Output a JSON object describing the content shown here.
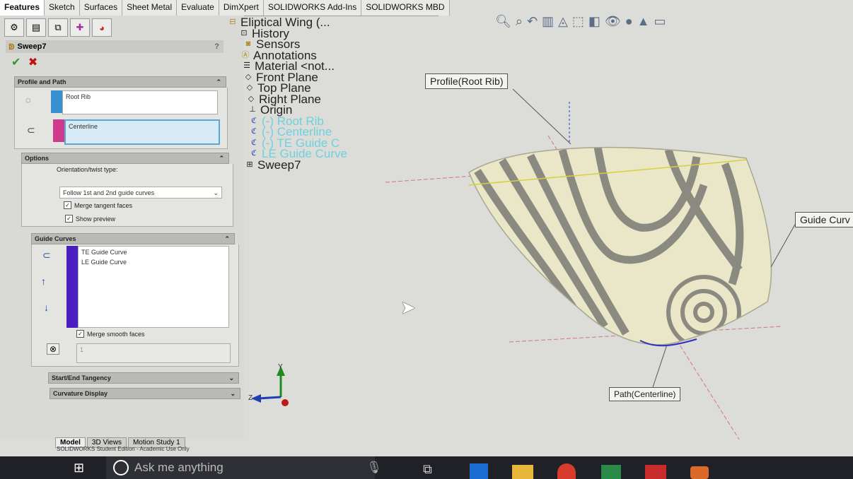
{
  "tabs": [
    "Features",
    "Sketch",
    "Surfaces",
    "Sheet Metal",
    "Evaluate",
    "DimXpert",
    "SOLIDWORKS Add-Ins",
    "SOLIDWORKS MBD"
  ],
  "pm": {
    "title": "Sweep7",
    "help": "?",
    "profile_path": {
      "header": "Profile and Path",
      "profile": "Root Rib",
      "path": "Centerline"
    },
    "options": {
      "header": "Options",
      "orientation_label": "Orientation/twist type:",
      "orientation_value": "Follow 1st and 2nd guide curves",
      "merge_tangent": "Merge tangent faces",
      "show_preview": "Show preview"
    },
    "guide": {
      "header": "Guide Curves",
      "items": [
        "TE Guide Curve",
        "LE Guide Curve"
      ],
      "merge_smooth": "Merge smooth faces",
      "spin_value": "1"
    },
    "start_end": "Start/End Tangency",
    "curvature": "Curvature Display"
  },
  "tree": {
    "root": "Eliptical Wing  (...",
    "items": [
      "History",
      "Sensors",
      "Annotations",
      "Material <not...",
      "Front Plane",
      "Top Plane",
      "Right Plane",
      "Origin"
    ],
    "sketches": [
      "(-) Root Rib",
      "(-) Centerline",
      "(-) TE Guide C",
      "LE Guide Curve"
    ],
    "last": "Sweep7"
  },
  "callouts": {
    "profile": "Profile(Root Rib)",
    "guide": "Guide Curv",
    "path": "Path(Centerline)"
  },
  "axes": {
    "y": "Y",
    "z": "Z"
  },
  "bottom_tabs": [
    "Model",
    "3D Views",
    "Motion Study 1"
  ],
  "status": "SOLIDWORKS Student Edition - Academic Use Only",
  "taskbar": {
    "search": "Ask me anything"
  }
}
